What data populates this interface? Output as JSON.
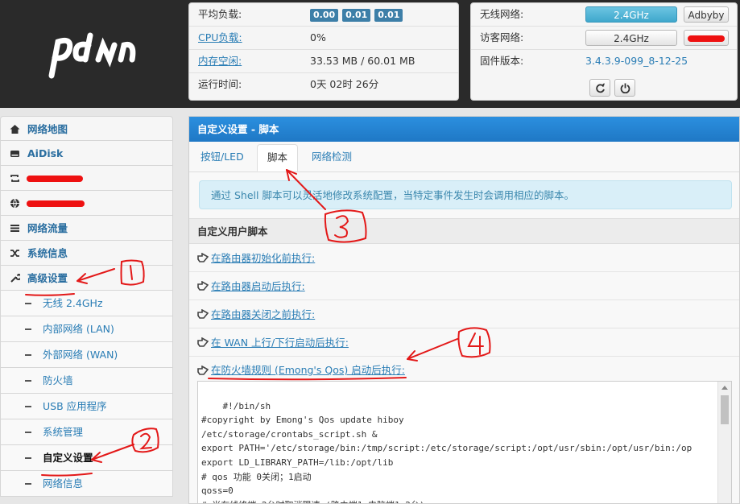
{
  "status": {
    "load_label": "平均负载:",
    "load_values": [
      "0.00",
      "0.01",
      "0.01"
    ],
    "cpu_label": "CPU负载:",
    "cpu_value": "0%",
    "mem_label": "内存空闲:",
    "mem_value": "33.53 MB / 60.01 MB",
    "uptime_label": "运行时间:",
    "uptime_value": "0天 02时 26分"
  },
  "network": {
    "wireless_label": "无线网络:",
    "wireless_btn": "2.4GHz",
    "adbyby_btn": "Adbyby",
    "guest_label": "访客网络:",
    "guest_btn": "2.4GHz",
    "firmware_label": "固件版本:",
    "firmware_value": "3.4.3.9-099_8-12-25"
  },
  "sidebar": {
    "items": [
      {
        "label": "网络地图",
        "icon": "home-icon"
      },
      {
        "label": "AiDisk",
        "icon": "hdd-icon"
      },
      {
        "label": "",
        "icon": "retweet-icon"
      },
      {
        "label": "",
        "icon": "globe-icon"
      },
      {
        "label": "网络流量",
        "icon": "list-icon"
      },
      {
        "label": "系统信息",
        "icon": "random-icon"
      },
      {
        "label": "高级设置",
        "icon": "wrench-icon"
      }
    ],
    "sub_items": [
      "无线 2.4GHz",
      "内部网络 (LAN)",
      "外部网络 (WAN)",
      "防火墙",
      "USB 应用程序",
      "系统管理",
      "自定义设置",
      "网络信息"
    ]
  },
  "main": {
    "title": "自定义设置 - 脚本",
    "tabs": [
      "按钮/LED",
      "脚本",
      "网络检测"
    ],
    "info": "通过 Shell 脚本可以灵活地修改系统配置，当特定事件发生时会调用相应的脚本。",
    "section_title": "自定义用户脚本",
    "scripts": [
      "在路由器初始化前执行:",
      "在路由器启动后执行:",
      "在路由器关闭之前执行:",
      "在 WAN 上行/下行启动后执行:",
      "在防火墙规则 (Emong's Qos) 启动后执行:"
    ],
    "code": "#!/bin/sh\n#copyright by Emong's Qos update hiboy\n/etc/storage/crontabs_script.sh &\nexport PATH='/etc/storage/bin:/tmp/script:/etc/storage/script:/opt/usr/sbin:/opt/usr/bin:/op\nexport LD_LIBRARY_PATH=/lib:/opt/lib\n# qos 功能 0关闭；1启动\nqoss=0\n# 当在线终端≤2台时取消限速.(路由端1+电脑端1=2台)"
  },
  "annotations": [
    "1",
    "2",
    "3",
    "4"
  ]
}
